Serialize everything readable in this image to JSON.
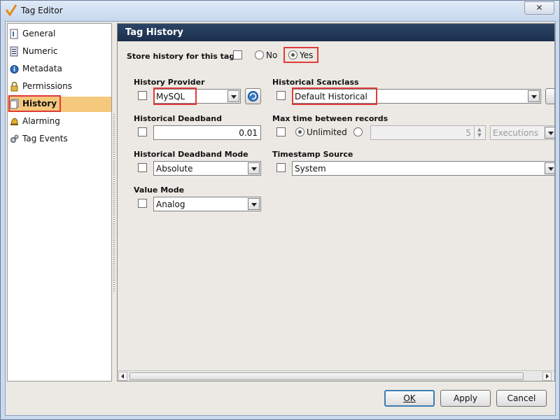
{
  "window": {
    "title": "Tag Editor",
    "close_glyph": "✕"
  },
  "nav": {
    "items": [
      {
        "label": "General",
        "icon": "page-info-icon"
      },
      {
        "label": "Numeric",
        "icon": "numeric-icon"
      },
      {
        "label": "Metadata",
        "icon": "info-icon"
      },
      {
        "label": "Permissions",
        "icon": "lock-icon"
      },
      {
        "label": "History",
        "icon": "history-pages-icon",
        "selected": true
      },
      {
        "label": "Alarming",
        "icon": "bell-icon"
      },
      {
        "label": "Tag Events",
        "icon": "gears-icon"
      }
    ]
  },
  "panel": {
    "header": "Tag History",
    "store_history": {
      "label": "Store history for this tag:",
      "no_label": "No",
      "yes_label": "Yes",
      "selected": "Yes"
    },
    "history_provider": {
      "label": "History Provider",
      "value": "MySQL"
    },
    "historical_scanclass": {
      "label": "Historical Scanclass",
      "value": "Default Historical"
    },
    "historical_deadband": {
      "label": "Historical Deadband",
      "value": "0.01"
    },
    "max_time": {
      "label": "Max time between records",
      "unlimited_label": "Unlimited",
      "selected": "Unlimited",
      "value": "5",
      "unit": "Executions"
    },
    "deadband_mode": {
      "label": "Historical Deadband Mode",
      "value": "Absolute"
    },
    "timestamp_source": {
      "label": "Timestamp Source",
      "value": "System"
    },
    "value_mode": {
      "label": "Value Mode",
      "value": "Analog"
    }
  },
  "buttons": {
    "ok": "OK",
    "apply": "Apply",
    "cancel": "Cancel"
  },
  "colors": {
    "header_bg": "#1e3352",
    "highlight": "#e03a3a",
    "nav_selected": "#f5c97c"
  }
}
